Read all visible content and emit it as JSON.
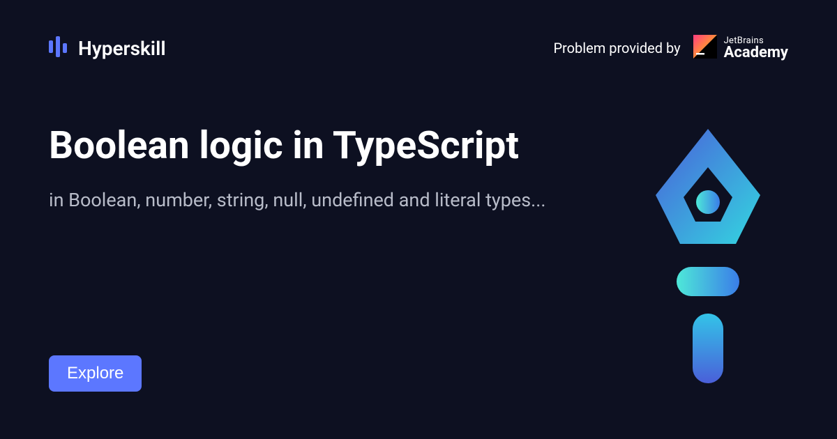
{
  "header": {
    "brand": "Hyperskill",
    "provider_label": "Problem provided by",
    "academy_top": "JetBrains",
    "academy_bottom": "Academy"
  },
  "main": {
    "title": "Boolean logic in TypeScript",
    "subtitle": "in Boolean, number, string, null, undefined and literal types...",
    "explore_label": "Explore"
  }
}
